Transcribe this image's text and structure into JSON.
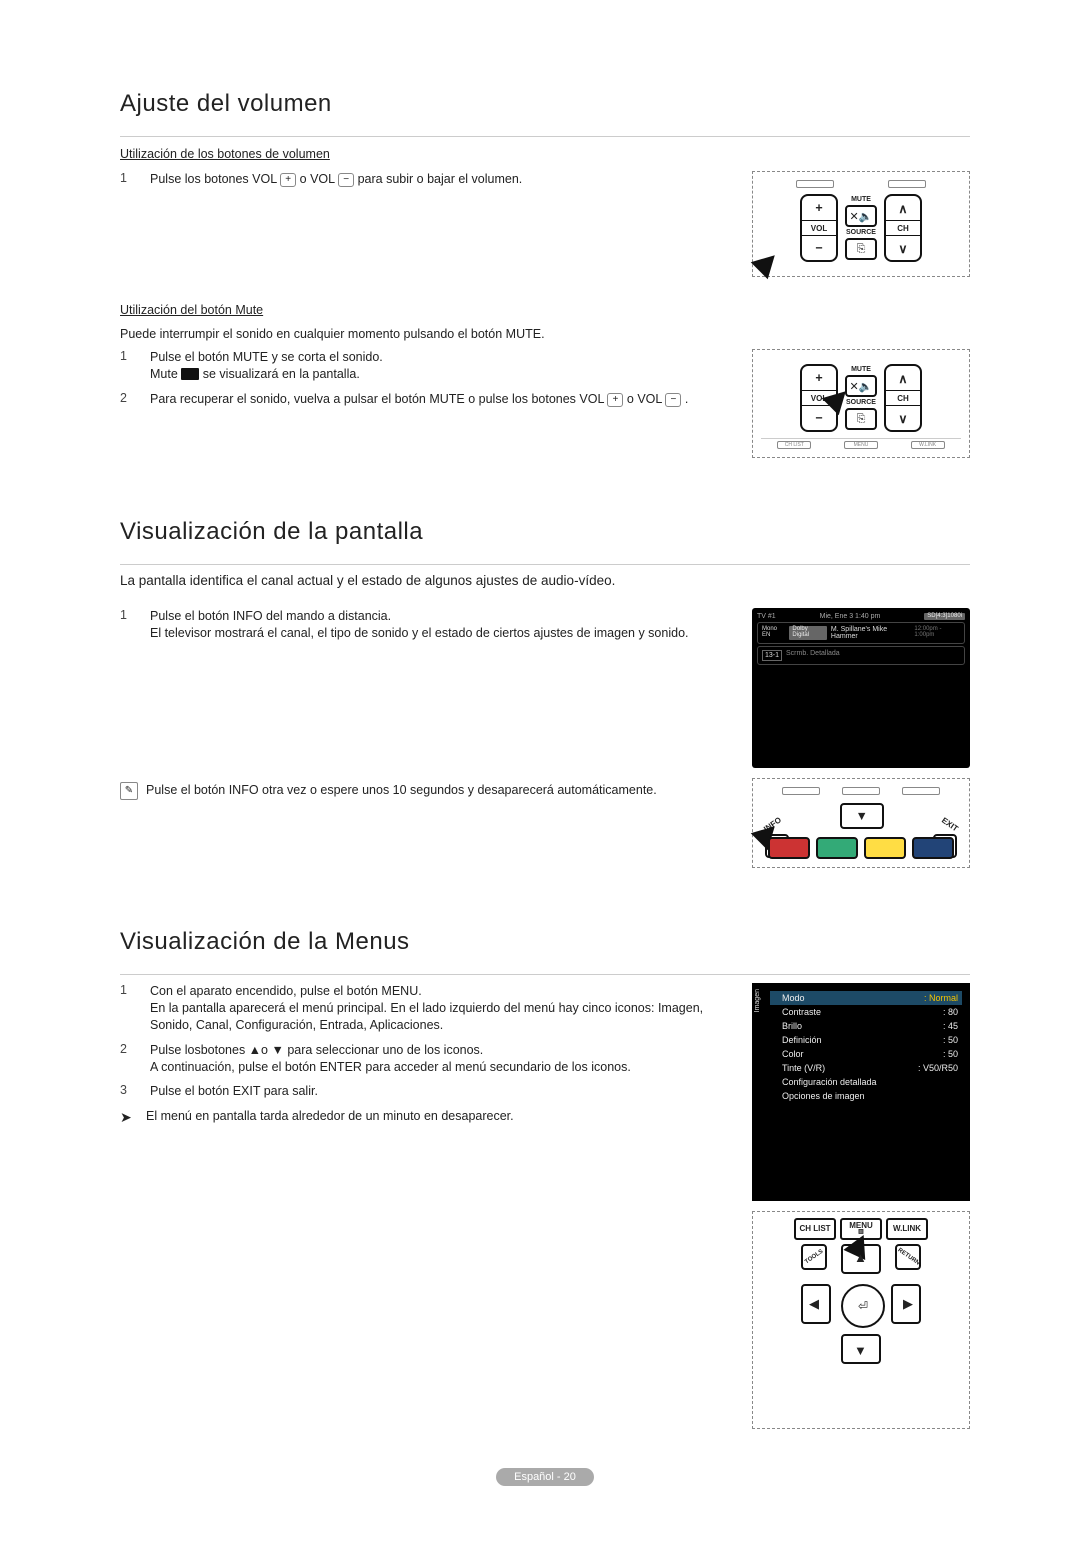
{
  "section1": {
    "title": "Ajuste del volumen",
    "sub1": "Utilización de los botones de volumen",
    "step1_num": "1",
    "step1_a": "Pulse los botones VOL ",
    "step1_b": " o VOL ",
    "step1_c": " para subir o bajar el volumen.",
    "sub2": "Utilización del botón Mute",
    "sub2_intro": "Puede interrumpir el sonido en cualquier momento pulsando el botón MUTE.",
    "step_m1_num": "1",
    "step_m1_line1": "Pulse el botón MUTE y se corta el sonido.",
    "step_m1_line2a": "Mute ",
    "step_m1_line2b": " se visualizará en la pantalla.",
    "step_m2_num": "2",
    "step_m2_a": "Para recuperar el sonido, vuelva a pulsar el botón MUTE o pulse los botones VOL ",
    "step_m2_b": " o VOL ",
    "step_m2_c": "."
  },
  "section2": {
    "title": "Visualización de la pantalla",
    "intro": "La pantalla identifica el canal actual y el estado de algunos ajustes de audio-vídeo.",
    "step1_num": "1",
    "step1_l1": "Pulse el botón INFO del mando a distancia.",
    "step1_l2": "El televisor mostrará el canal, el tipo de sonido y el estado de ciertos ajustes de imagen y sonido.",
    "note1": "Pulse el botón INFO otra vez o espere unos 10 segundos y desaparecerá automáticamente.",
    "tv": {
      "tl": "TV #1",
      "time": "Mie, Ene 3 1:40 pm",
      "res": "SD[4:3]1080i",
      "source_lang": "Mono EN",
      "audio": "Dolby Digital",
      "prog": "M. Spillane's Mike Hammer",
      "range": "12:00pm - 1:00pm",
      "chan": "13-1",
      "hint": "Scrmb. Detallada"
    }
  },
  "section3": {
    "title": "Visualización de la Menus",
    "step1_num": "1",
    "step1": "Con el aparato encendido, pulse el botón MENU.\nEn la pantalla aparecerá el menú principal. En el lado izquierdo del menú hay cinco iconos: Imagen, Sonido, Canal, Configuración, Entrada, Aplicaciones.",
    "step2_num": "2",
    "step2": "Pulse losbotones ▲o ▼ para seleccionar uno de los iconos.\nA continuación, pulse el botón ENTER para acceder al menú secundario de los iconos.",
    "step3_num": "3",
    "step3": "Pulse el botón EXIT para salir.",
    "note": "El menú en pantalla tarda alrededor de un minuto en desaparecer.",
    "osd": {
      "sidetab": "Imagen",
      "rows": [
        {
          "label": "Modo",
          "val": ": Normal",
          "hl": true
        },
        {
          "label": "Contraste",
          "val": ": 80"
        },
        {
          "label": "Brillo",
          "val": ": 45"
        },
        {
          "label": "Definición",
          "val": ": 50"
        },
        {
          "label": "Color",
          "val": ": 50"
        },
        {
          "label": "Tinte (V/R)",
          "val": ": V50/R50"
        },
        {
          "label": "Configuración detallada",
          "val": ""
        },
        {
          "label": "Opciones de imagen",
          "val": ""
        }
      ]
    }
  },
  "remote": {
    "vol": "VOL",
    "ch": "CH",
    "mute": "MUTE",
    "source": "SOURCE",
    "plus": "+",
    "minus": "−",
    "info": "INFO",
    "exit": "EXIT",
    "chlist": "CH LIST",
    "menu": "MENU",
    "wlink": "W.LINK",
    "tools": "TOOLS",
    "return": "RETURN"
  },
  "footer": "Español - 20"
}
